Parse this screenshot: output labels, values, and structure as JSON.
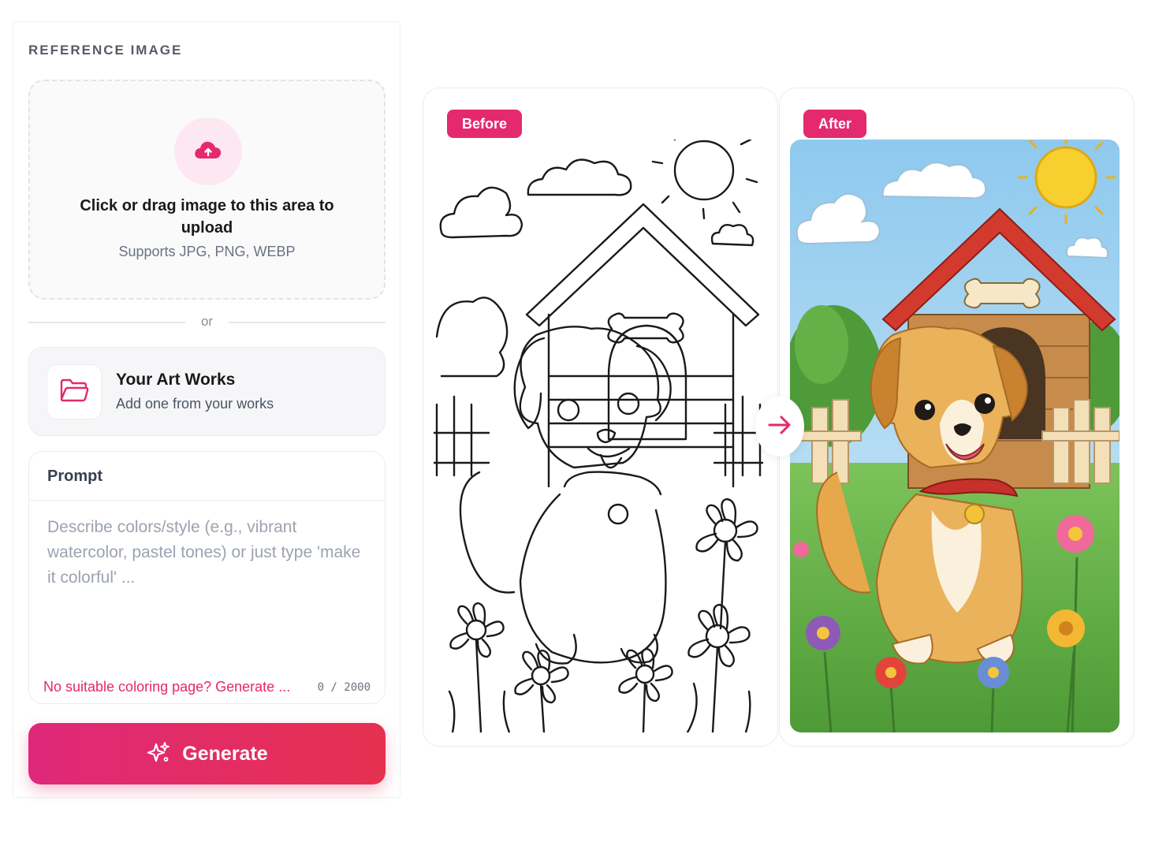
{
  "reference": {
    "section_title": "REFERENCE IMAGE",
    "upload": {
      "title": "Click or drag image to this area to upload",
      "subtitle": "Supports JPG, PNG, WEBP",
      "icon": "cloud-upload-icon"
    },
    "divider_text": "or",
    "artworks": {
      "title": "Your Art Works",
      "subtitle": "Add one from your works",
      "icon": "folder-icon"
    }
  },
  "prompt": {
    "label": "Prompt",
    "placeholder": "Describe colors/style (e.g., vibrant watercolor, pastel tones) or just type 'make it colorful' ...",
    "value": "",
    "generate_link": "No suitable coloring page? Generate ...",
    "char_count": "0 / 2000"
  },
  "generate": {
    "label": "Generate",
    "icon": "sparkles-icon"
  },
  "compare": {
    "before_label": "Before",
    "after_label": "After",
    "arrow_icon": "arrow-right-icon"
  },
  "colors": {
    "accent": "#e5296f",
    "button_gradient_start": "#e0287a",
    "button_gradient_end": "#e5314f"
  }
}
